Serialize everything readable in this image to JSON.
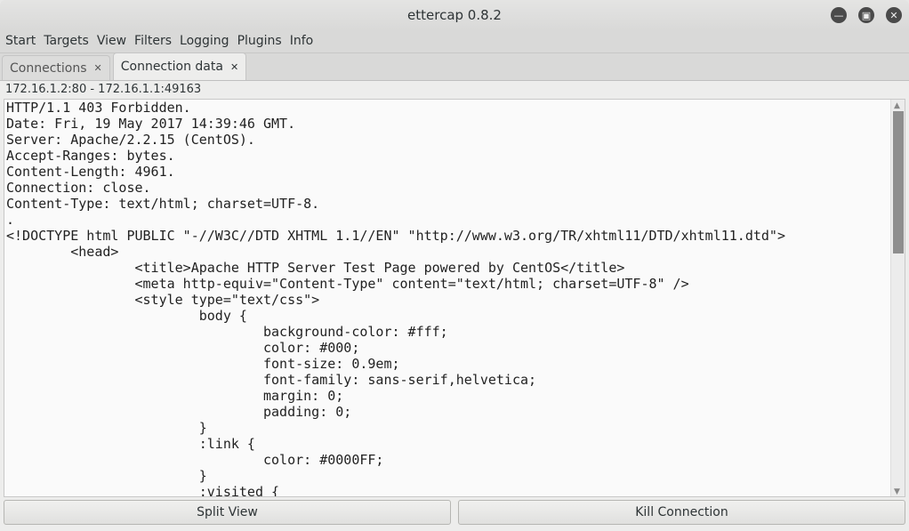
{
  "window": {
    "title": "ettercap 0.8.2"
  },
  "menu": [
    "Start",
    "Targets",
    "View",
    "Filters",
    "Logging",
    "Plugins",
    "Info"
  ],
  "tabs": [
    {
      "label": "Connections",
      "active": false
    },
    {
      "label": "Connection data",
      "active": true
    }
  ],
  "connection": "172.16.1.2:80 - 172.16.1.1:49163",
  "data_lines": [
    "HTTP/1.1 403 Forbidden.",
    "Date: Fri, 19 May 2017 14:39:46 GMT.",
    "Server: Apache/2.2.15 (CentOS).",
    "Accept-Ranges: bytes.",
    "Content-Length: 4961.",
    "Connection: close.",
    "Content-Type: text/html; charset=UTF-8.",
    ".",
    "<!DOCTYPE html PUBLIC \"-//W3C//DTD XHTML 1.1//EN\" \"http://www.w3.org/TR/xhtml11/DTD/xhtml11.dtd\">",
    "\t<head>",
    "\t\t<title>Apache HTTP Server Test Page powered by CentOS</title>",
    "\t\t<meta http-equiv=\"Content-Type\" content=\"text/html; charset=UTF-8\" />",
    "\t\t<style type=\"text/css\">",
    "\t\t\tbody {",
    "\t\t\t\tbackground-color: #fff;",
    "\t\t\t\tcolor: #000;",
    "\t\t\t\tfont-size: 0.9em;",
    "\t\t\t\tfont-family: sans-serif,helvetica;",
    "\t\t\t\tmargin: 0;",
    "\t\t\t\tpadding: 0;",
    "\t\t\t}",
    "\t\t\t:link {",
    "\t\t\t\tcolor: #0000FF;",
    "\t\t\t}",
    "\t\t\t:visited {"
  ],
  "buttons": {
    "split": "Split View",
    "kill": "Kill Connection"
  }
}
